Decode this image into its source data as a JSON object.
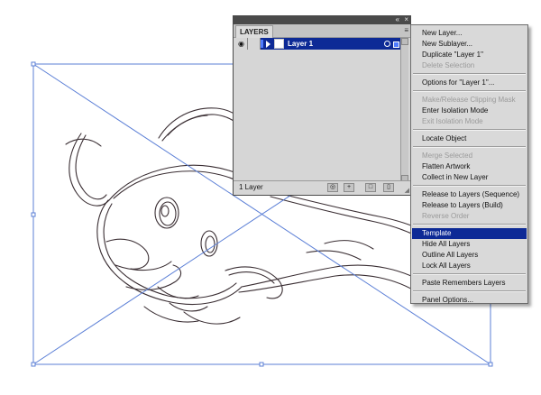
{
  "layers_panel": {
    "tab_label": "LAYERS",
    "collapse_icon": "«",
    "close_icon": "×",
    "menu_icon": "≡",
    "layer": {
      "name": "Layer 1",
      "color": "#4f7cff"
    },
    "layer_count": "1 Layer",
    "footer_buttons": [
      "make-clipping-mask",
      "create-new-sublayer",
      "create-new-layer",
      "delete-layer"
    ]
  },
  "flyout_menu": {
    "groups": [
      [
        {
          "label": "New Layer...",
          "enabled": true
        },
        {
          "label": "New Sublayer...",
          "enabled": true
        },
        {
          "label": "Duplicate \"Layer 1\"",
          "enabled": true
        },
        {
          "label": "Delete Selection",
          "enabled": false
        }
      ],
      [
        {
          "label": "Options for \"Layer 1\"...",
          "enabled": true
        }
      ],
      [
        {
          "label": "Make/Release Clipping Mask",
          "enabled": false
        },
        {
          "label": "Enter Isolation Mode",
          "enabled": true
        },
        {
          "label": "Exit Isolation Mode",
          "enabled": false
        }
      ],
      [
        {
          "label": "Locate Object",
          "enabled": true
        }
      ],
      [
        {
          "label": "Merge Selected",
          "enabled": false
        },
        {
          "label": "Flatten Artwork",
          "enabled": true
        },
        {
          "label": "Collect in New Layer",
          "enabled": true
        }
      ],
      [
        {
          "label": "Release to Layers (Sequence)",
          "enabled": true
        },
        {
          "label": "Release to Layers (Build)",
          "enabled": true
        },
        {
          "label": "Reverse Order",
          "enabled": false
        }
      ],
      [
        {
          "label": "Template",
          "enabled": true,
          "highlighted": true
        },
        {
          "label": "Hide All Layers",
          "enabled": true
        },
        {
          "label": "Outline All Layers",
          "enabled": true
        },
        {
          "label": "Lock All Layers",
          "enabled": true
        }
      ],
      [
        {
          "label": "Paste Remembers Layers",
          "enabled": true
        }
      ],
      [
        {
          "label": "Panel Options...",
          "enabled": true
        }
      ]
    ]
  },
  "colors": {
    "selection_blue": "#0d2a96",
    "bounding_box": "#5b7fd6",
    "sketch_stroke": "#3a2e33"
  }
}
